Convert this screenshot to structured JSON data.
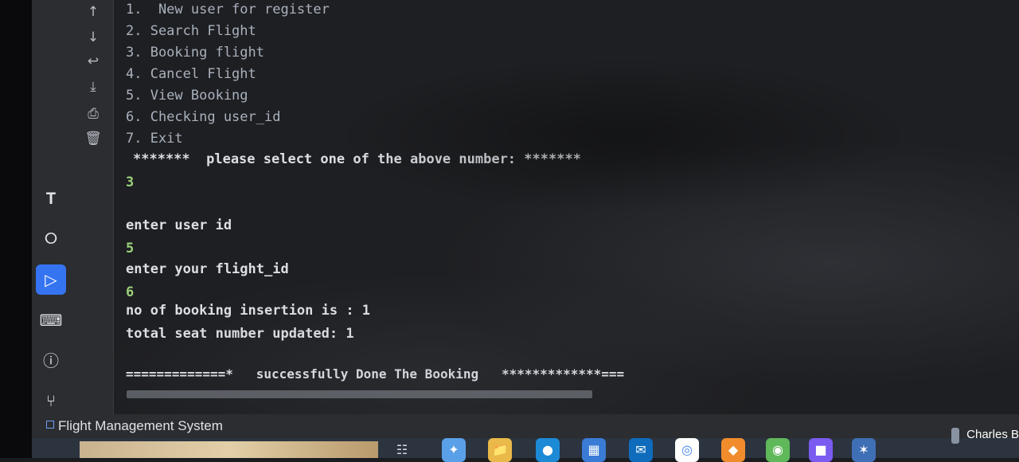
{
  "console": {
    "menu": [
      "1.  New user for register",
      "2. Search Flight",
      "3. Booking flight",
      "4. Cancel Flight",
      "5. View Booking",
      "6. Checking user_id",
      "7. Exit"
    ],
    "select_prompt": "*******  please select one of the above number: *******",
    "choice": "3",
    "prompt_user_id": "enter user id",
    "user_id": "5",
    "prompt_flight_id": "enter your flight_id",
    "flight_id": "6",
    "booking_insertion": "no of booking insertion is : 1",
    "seat_updated": "total seat number updated: 1",
    "success": "=============*   successfully Done The Booking   *************==="
  },
  "tool_icons": [
    "up-arrow-icon",
    "down-arrow-icon",
    "soft-wrap-icon",
    "scroll-to-end-icon",
    "print-icon",
    "trash-icon"
  ],
  "side_icons": [
    "build-icon",
    "services-icon",
    "run-icon",
    "terminal-icon",
    "problems-icon",
    "git-icon"
  ],
  "status": {
    "project": "Flight Management System"
  },
  "taskbar": {
    "user": "Charles B"
  },
  "colors": {
    "background": "#1e1f22",
    "panel": "#2b2d30",
    "accent": "#3574f0",
    "input_text": "#9ad17a"
  }
}
